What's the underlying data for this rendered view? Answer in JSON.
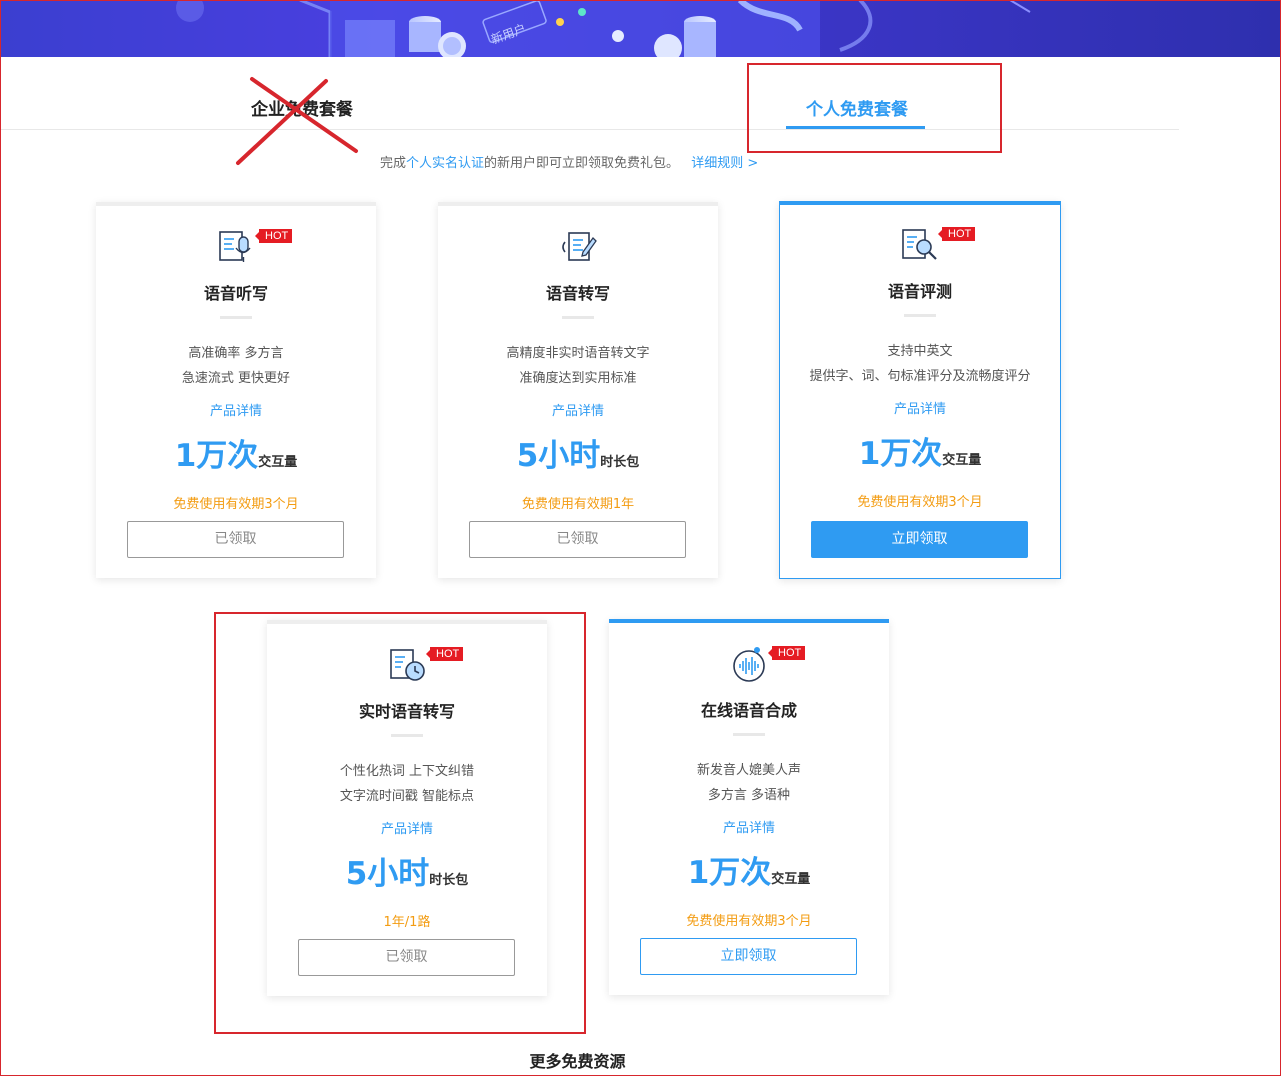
{
  "banner": {
    "badge": "新用户"
  },
  "tabs": {
    "enterprise": "企业免费套餐",
    "personal": "个人免费套餐"
  },
  "notice": {
    "prefix": "完成",
    "link": "个人实名认证",
    "suffix": "的新用户即可立即领取免费礼包。",
    "rules": "详细规则 >"
  },
  "cards": [
    {
      "title": "语音听写",
      "desc1": "高准确率 多方言",
      "desc2": "急速流式 更快更好",
      "detail": "产品详情",
      "amount": "1万次",
      "unit": "交互量",
      "validity": "免费使用有效期3个月",
      "button": "已领取",
      "hot": "HOT",
      "icon": "microphone-icon"
    },
    {
      "title": "语音转写",
      "desc1": "高精度非实时语音转文字",
      "desc2": "准确度达到实用标准",
      "detail": "产品详情",
      "amount": "5小时",
      "unit": "时长包",
      "validity": "免费使用有效期1年",
      "button": "已领取",
      "icon": "transcribe-pen-icon"
    },
    {
      "title": "语音评测",
      "desc1": "支持中英文",
      "desc2": "提供字、词、句标准评分及流畅度评分",
      "detail": "产品详情",
      "amount": "1万次",
      "unit": "交互量",
      "validity": "免费使用有效期3个月",
      "button": "立即领取",
      "hot": "HOT",
      "icon": "magnifier-document-icon"
    },
    {
      "title": "实时语音转写",
      "desc1": "个性化热词 上下文纠错",
      "desc2": "文字流时间戳 智能标点",
      "detail": "产品详情",
      "amount": "5小时",
      "unit": "时长包",
      "validity": "1年/1路",
      "button": "已领取",
      "hot": "HOT",
      "icon": "clock-document-icon"
    },
    {
      "title": "在线语音合成",
      "desc1": "新发音人媲美人声",
      "desc2": "多方言 多语种",
      "detail": "产品详情",
      "amount": "1万次",
      "unit": "交互量",
      "validity": "免费使用有效期3个月",
      "button": "立即领取",
      "hot": "HOT",
      "icon": "sound-wave-icon"
    }
  ],
  "more_resources": "更多免费资源",
  "colors": {
    "accent": "#2f9bf2",
    "hot": "#e51c23",
    "validity": "#f39c12",
    "annotation": "#d7262d"
  }
}
